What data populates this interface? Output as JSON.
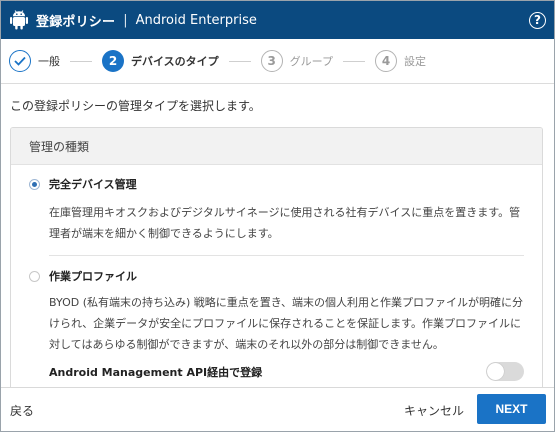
{
  "header": {
    "title": "登録ポリシー",
    "separator": "|",
    "subtitle": "Android Enterprise",
    "help_glyph": "?",
    "logo_icon": "android-icon",
    "color": "#0b4a80"
  },
  "steps": [
    {
      "number": "",
      "label": "一般",
      "state": "done"
    },
    {
      "number": "2",
      "label": "デバイスのタイプ",
      "state": "active"
    },
    {
      "number": "3",
      "label": "グループ",
      "state": "todo"
    },
    {
      "number": "4",
      "label": "設定",
      "state": "todo"
    }
  ],
  "intro": "この登録ポリシーの管理タイプを選択します。",
  "card": {
    "heading": "管理の種類",
    "options": [
      {
        "label": "完全デバイス管理",
        "selected": true,
        "description": "在庫管理用キオスクおよびデジタルサイネージに使用される社有デバイスに重点を置きます。管理者が端末を細かく制御できるようにします。"
      },
      {
        "label": "作業プロファイル",
        "selected": false,
        "description": "BYOD (私有端末の持ち込み) 戦略に重点を置き、端末の個人利用と作業プロファイルが明確に分けられ、企業データが安全にプロファイルに保存されることを保証します。作業プロファイルに対してはあらゆる制御ができますが、端末のそれ以外の部分は制御できません。"
      }
    ],
    "toggle": {
      "label": "Android Management API経由で登録",
      "on": false
    }
  },
  "footer": {
    "back": "戻る",
    "cancel": "キャンセル",
    "next": "NEXT",
    "accent": "#1a73c6"
  }
}
